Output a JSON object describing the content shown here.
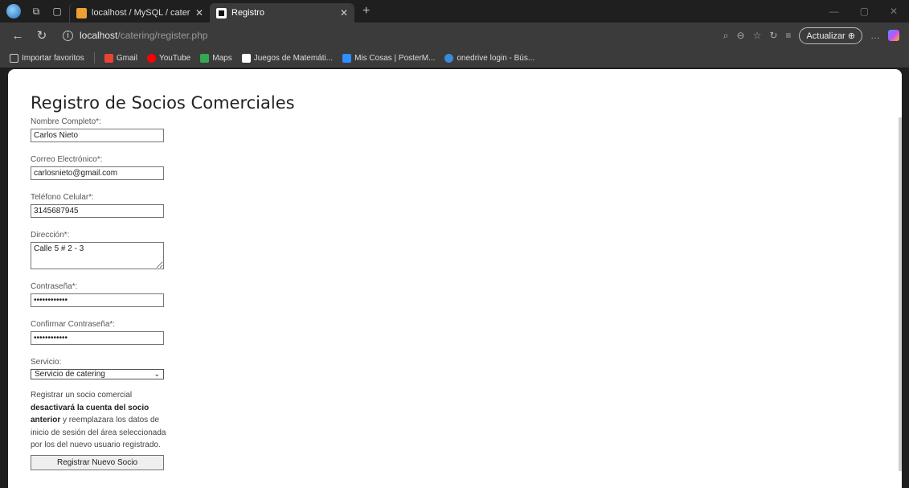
{
  "browser": {
    "tabs": [
      {
        "label": "localhost / MySQL / cateringdb / "
      },
      {
        "label": "Registro"
      }
    ],
    "url_host": "localhost",
    "url_path": "/catering/register.php",
    "update_label": "Actualizar",
    "bookmarks": [
      {
        "label": "Importar favoritos"
      },
      {
        "label": "Gmail"
      },
      {
        "label": "YouTube"
      },
      {
        "label": "Maps"
      },
      {
        "label": "Juegos de Matemáti..."
      },
      {
        "label": "Mis Cosas | PosterM..."
      },
      {
        "label": "onedrive login - Bús..."
      }
    ]
  },
  "form": {
    "title": "Registro de Socios Comerciales",
    "fields": {
      "nombre": {
        "label": "Nombre Completo*:",
        "value": "Carlos Nieto"
      },
      "correo": {
        "label": "Correo Electrónico*:",
        "value": "carlosnieto@gmail.com"
      },
      "telefono": {
        "label": "Teléfono Celular*:",
        "value": "3145687945"
      },
      "direccion": {
        "label": "Dirección*:",
        "value": "Calle 5 # 2 - 3"
      },
      "password": {
        "label": "Contraseña*:",
        "value": "••••••••••••"
      },
      "confirm": {
        "label": "Confirmar Contraseña*:",
        "value": "••••••••••••"
      },
      "servicio": {
        "label": "Servicio:",
        "value": "Servicio de catering"
      }
    },
    "note": {
      "part1": "Registrar un socio comercial ",
      "bold": "desactivará la cuenta del socio anterior",
      "part2": " y reemplazara los datos de inicio de sesión del área seleccionada por los del nuevo usuario registrado."
    },
    "submit_label": "Registrar Nuevo Socio"
  }
}
